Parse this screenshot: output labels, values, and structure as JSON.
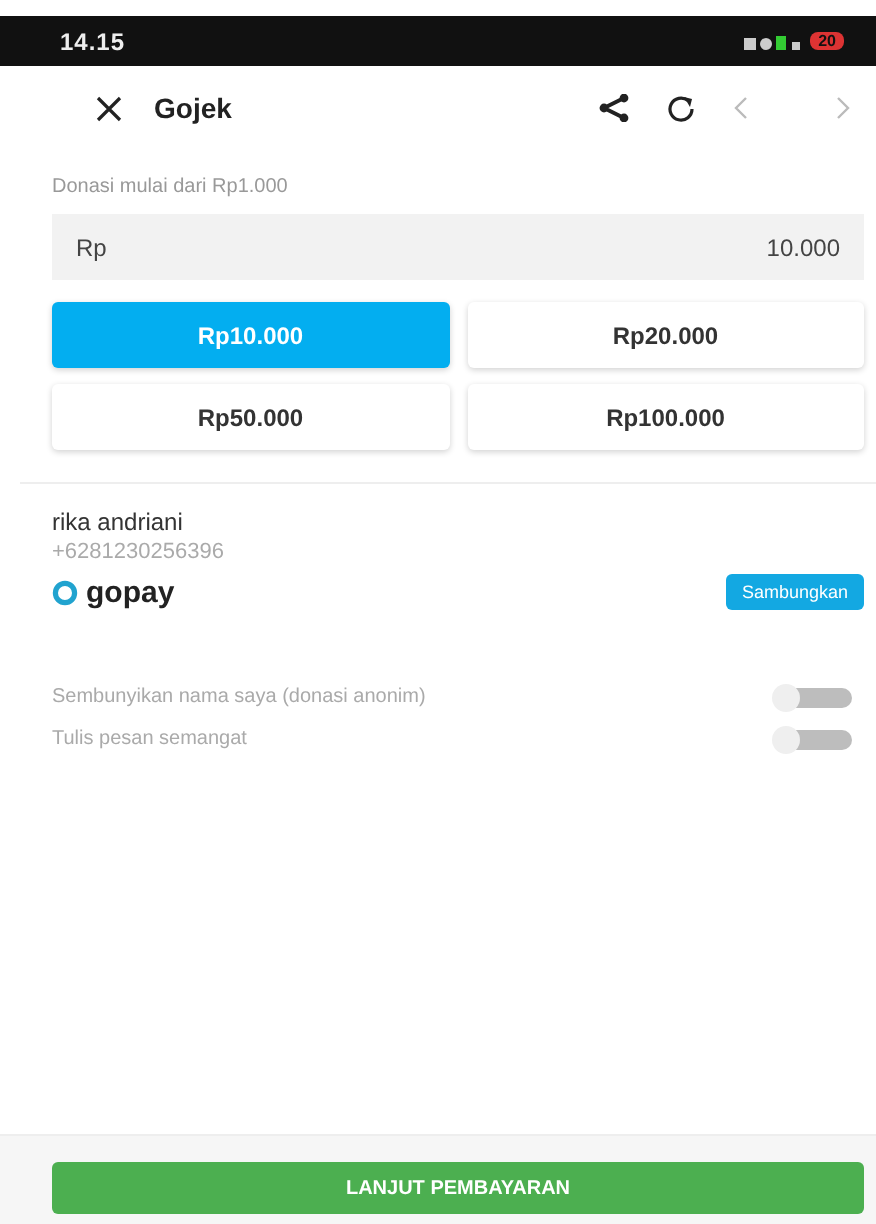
{
  "status_bar": {
    "time": "14.15",
    "battery": "20"
  },
  "header": {
    "title": "Gojek"
  },
  "donation": {
    "hint": "Donasi mulai dari Rp1.000",
    "currency": "Rp",
    "value": "10.000"
  },
  "amounts": [
    {
      "label": "Rp10.000",
      "selected": true
    },
    {
      "label": "Rp20.000",
      "selected": false
    },
    {
      "label": "Rp50.000",
      "selected": false
    },
    {
      "label": "Rp100.000",
      "selected": false
    }
  ],
  "account": {
    "name": "rika andriani",
    "phone": "+6281230256396",
    "wallet": "gopay",
    "connect_button": "Sambungkan"
  },
  "options": [
    {
      "label": "Sembunyikan nama saya (donasi anonim)",
      "on": false
    },
    {
      "label": "Tulis pesan semangat",
      "on": false
    }
  ],
  "submit_button": "LANJUT PEMBAYARAN"
}
